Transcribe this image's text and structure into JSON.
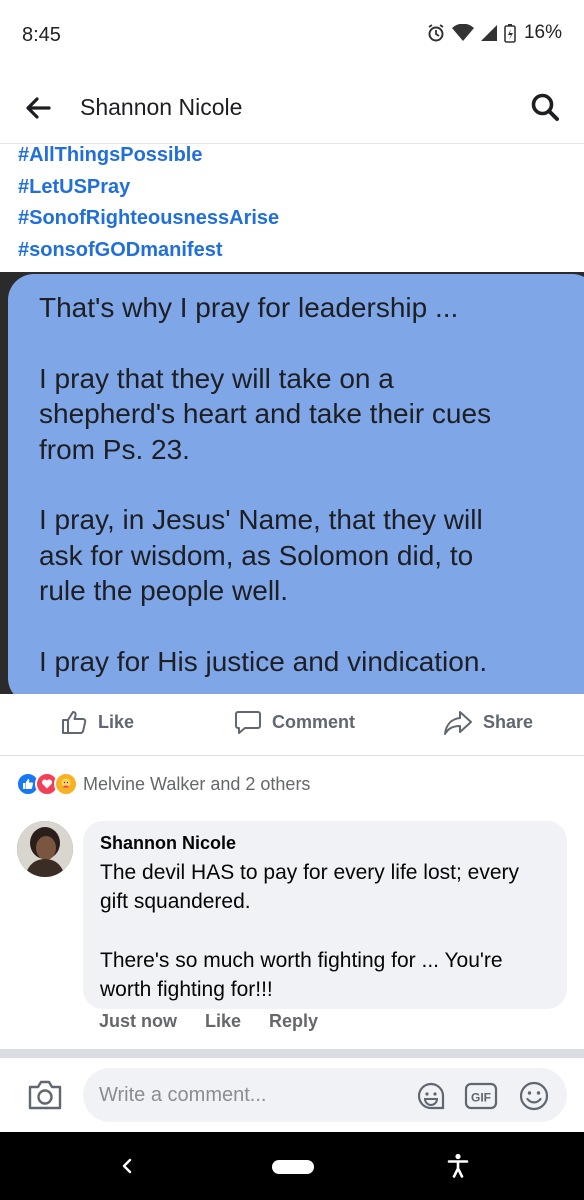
{
  "status_bar": {
    "time": "8:45",
    "battery": "16%",
    "icons": [
      "alarm-icon",
      "wifi-icon",
      "signal-icon",
      "battery-charging-icon"
    ]
  },
  "app_bar": {
    "title": "Shannon Nicole",
    "back_icon": "arrow-left-icon",
    "search_icon": "search-icon"
  },
  "hashtags": [
    "#AllThingsPossible",
    "#LetUSPray",
    "#SonofRighteousnessArise",
    "#sonsofGODmanifest"
  ],
  "post_image": {
    "paragraph1": [
      "That's why I pray for leadership ..."
    ],
    "paragraph2": [
      "I pray that they will take on a",
      "shepherd's heart and take their cues",
      "from Ps. 23."
    ],
    "paragraph3": [
      "I pray, in Jesus' Name, that they will",
      "ask for wisdom, as Solomon did, to",
      "rule the people well."
    ],
    "paragraph4": [
      "I pray for His justice and vindication."
    ]
  },
  "actions": {
    "like": "Like",
    "comment": "Comment",
    "share": "Share"
  },
  "reactions": {
    "text": "Melvine Walker and 2 others",
    "types": [
      "like",
      "love",
      "care"
    ]
  },
  "comment": {
    "author": "Shannon Nicole",
    "lines1": [
      "The devil HAS to pay for every life lost; every",
      "gift squandered."
    ],
    "lines2": [
      "There's so much worth fighting for ... You're",
      "worth fighting for!!!"
    ],
    "time": "Just now",
    "like": "Like",
    "reply": "Reply"
  },
  "composer": {
    "placeholder": "Write a comment..."
  },
  "colors": {
    "accent": "#216fdb",
    "bubble": "#7fa6e6",
    "comment_bg": "#f0f2f5"
  }
}
